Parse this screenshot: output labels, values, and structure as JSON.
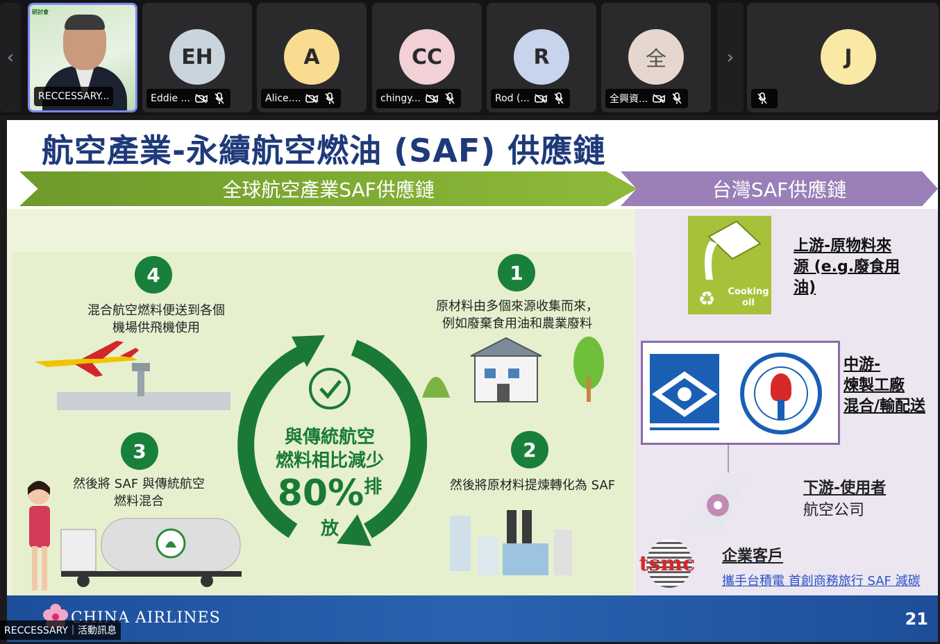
{
  "participants": [
    {
      "name": "RECCESSARY...",
      "initials": "",
      "video": true,
      "speaker_logo": "研討會",
      "cam_off": false,
      "mic_muted": false
    },
    {
      "name": "Eddie ...",
      "initials": "EH",
      "color": "#c9d4dd"
    },
    {
      "name": "Alice....",
      "initials": "A",
      "color": "#f9dc8f"
    },
    {
      "name": "chingy...",
      "initials": "CC",
      "color": "#f1d0d6"
    },
    {
      "name": "Rod (...",
      "initials": "R",
      "color": "#c8d3ec"
    },
    {
      "name": "全興資...",
      "initials": "全",
      "color": "#e6d7ce"
    },
    {
      "name": "",
      "initials": "J",
      "color": "#fae8a5"
    }
  ],
  "slide": {
    "title": "航空產業-永續航空燃油 (SAF) 供應鏈",
    "banner_global": "全球航空產業SAF供應鏈",
    "banner_taiwan": "台灣SAF供應鏈",
    "steps": [
      {
        "num": "4",
        "text_l1": "混合航空燃料便送到各個",
        "text_l2": "機場供飛機使用"
      },
      {
        "num": "1",
        "text_l1": "原材料由多個來源收集而來，",
        "text_l2": "例如廢棄食用油和農業廢料"
      },
      {
        "num": "3",
        "text_l1": "然後將 SAF 與傳統航空",
        "text_l2": "燃料混合"
      },
      {
        "num": "2",
        "text_l1": "然後將原材料提煉轉化為 SAF",
        "text_l2": ""
      }
    ],
    "cycle_l1": "與傳統航空",
    "cycle_l2": "燃料相比減少",
    "cycle_pct": "80%",
    "cycle_suffix": "排放",
    "upstream_l1": "上游-原物料來",
    "upstream_l2": "源 (e.g.廢食用",
    "upstream_l3": "油)",
    "cooking_l1": "Cooking",
    "cooking_l2": "oil",
    "midstream_l1": "中游-",
    "midstream_l2": "煉製工廠",
    "midstream_l3": "混合/輸配送",
    "downstream_title": "下游-使用者",
    "downstream_sub": "航空公司",
    "corporate_title": "企業客戶",
    "corporate_link": "攜手台積電 首創商務旅行 SAF 減碳",
    "tsmc_logo": "tsmc",
    "footer_brand": "CHINA AIRLINES",
    "page_number": "21"
  },
  "caption": "RECCESSARY｜活動訊息",
  "colors": {
    "accent": "#7b86f0",
    "green": "#18803a",
    "purple": "#9a7fb8",
    "title": "#1f3a7a"
  }
}
